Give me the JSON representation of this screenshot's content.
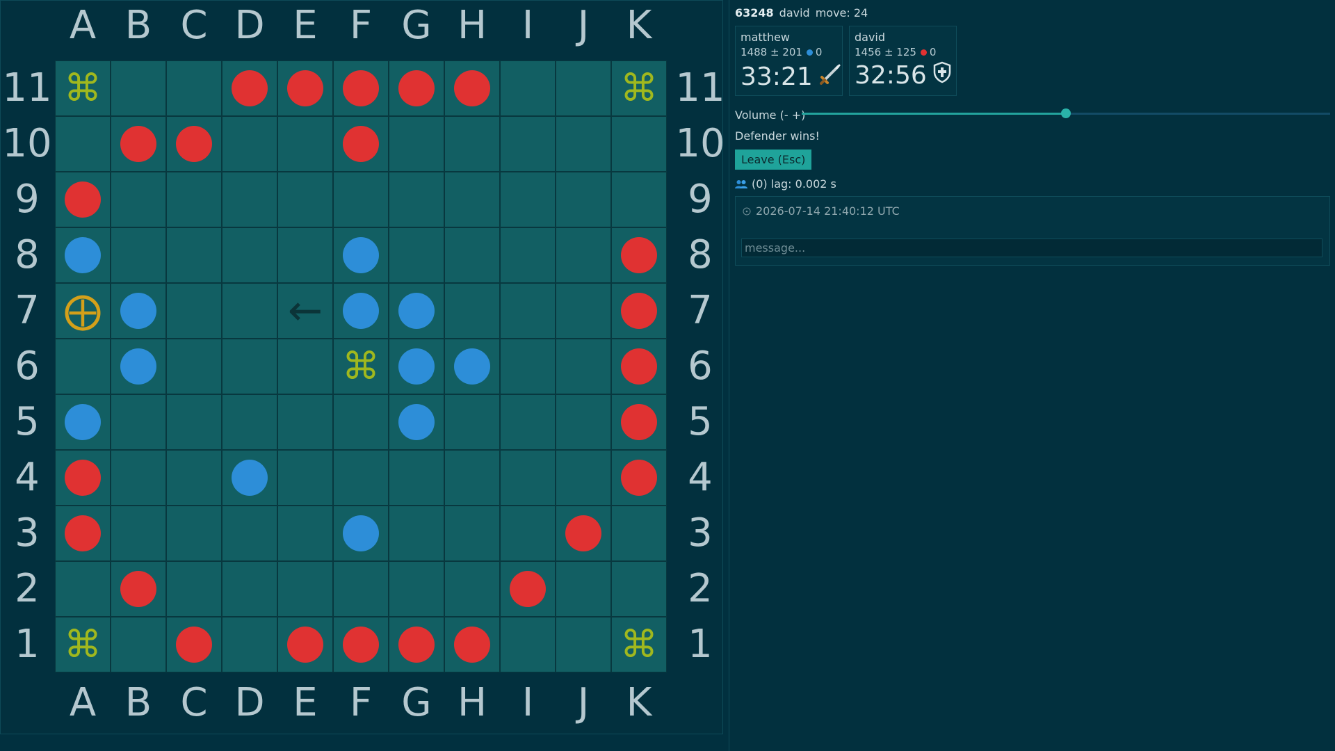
{
  "board": {
    "columns": [
      "A",
      "B",
      "C",
      "D",
      "E",
      "F",
      "G",
      "H",
      "I",
      "J",
      "K"
    ],
    "rows": [
      "11",
      "10",
      "9",
      "8",
      "7",
      "6",
      "5",
      "4",
      "3",
      "2",
      "1"
    ],
    "cells": [
      [
        "corner",
        "",
        "",
        "red",
        "red",
        "red",
        "red",
        "red",
        "",
        "",
        "corner"
      ],
      [
        "",
        "red",
        "red",
        "",
        "",
        "red",
        "",
        "",
        "",
        "",
        ""
      ],
      [
        "red",
        "",
        "",
        "",
        "",
        "",
        "",
        "",
        "",
        "",
        ""
      ],
      [
        "blue",
        "",
        "",
        "",
        "",
        "blue",
        "",
        "",
        "",
        "",
        "red"
      ],
      [
        "king",
        "blue",
        "",
        "",
        "arrow",
        "blue",
        "blue",
        "",
        "",
        "",
        "red"
      ],
      [
        "",
        "blue",
        "",
        "",
        "",
        "corner",
        "blue",
        "blue",
        "",
        "",
        "red"
      ],
      [
        "blue",
        "",
        "",
        "",
        "",
        "",
        "blue",
        "",
        "",
        "",
        "red"
      ],
      [
        "red",
        "",
        "",
        "blue",
        "",
        "",
        "",
        "",
        "",
        "",
        "red"
      ],
      [
        "red",
        "",
        "",
        "",
        "",
        "blue",
        "",
        "",
        "",
        "red",
        ""
      ],
      [
        "",
        "red",
        "",
        "",
        "",
        "",
        "",
        "",
        "red",
        "",
        ""
      ],
      [
        "corner",
        "",
        "red",
        "",
        "red",
        "red",
        "red",
        "red",
        "",
        "",
        "corner"
      ]
    ],
    "glyphs": {
      "corner": "⌘",
      "arrow": "←",
      "king": "⨁"
    },
    "colors": {
      "red": "#e03232",
      "blue": "#2d8ed8",
      "cell": "#125f63"
    }
  },
  "header": {
    "game_id": "63248",
    "player": "david",
    "move": "move: 24"
  },
  "players": [
    {
      "name": "matthew",
      "rating": "1488 ± 201",
      "color": "blue",
      "captures": "0",
      "clock": "33:21",
      "role_icon": "sword-icon"
    },
    {
      "name": "david",
      "rating": "1456 ± 125",
      "color": "red",
      "captures": "0",
      "clock": "32:56",
      "role_icon": "shield-icon"
    }
  ],
  "volume": {
    "label": "Volume (- +)",
    "level": 0.5
  },
  "result": "Defender wins!",
  "leave_button": "Leave (Esc)",
  "lag": {
    "icon": "users-icon",
    "text": "(0) lag: 0.002 s"
  },
  "chat": {
    "timestamp": "2026-07-14 21:40:12 UTC",
    "placeholder": "message..."
  }
}
